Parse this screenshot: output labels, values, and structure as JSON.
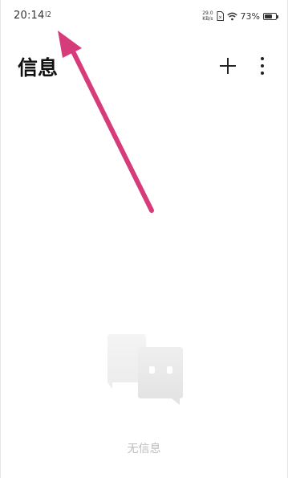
{
  "status_bar": {
    "time": "20:14",
    "notification": "I2",
    "net_speed_value": "29.0",
    "net_speed_unit": "KB/s",
    "battery_percent": "73%",
    "battery_level": 0.73
  },
  "header": {
    "title": "信息"
  },
  "empty_state": {
    "message": "无信息"
  },
  "icons": {
    "add": "plus-icon",
    "more": "more-vertical-icon",
    "wifi": "wifi-icon",
    "sim": "sim-card-icon",
    "battery": "battery-icon",
    "illustration": "chat-bubbles-icon"
  },
  "colors": {
    "annotation_arrow": "#d63b7a",
    "empty_text": "#bdbdbd"
  }
}
